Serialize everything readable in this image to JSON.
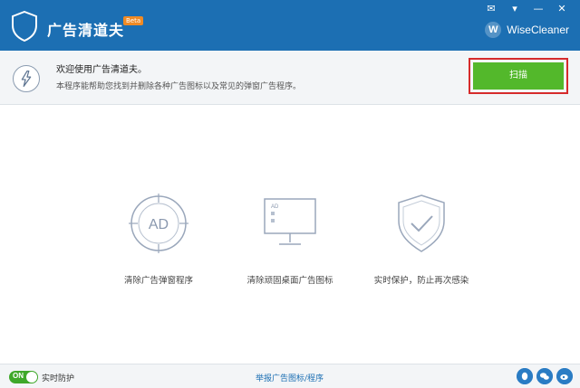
{
  "header": {
    "app_title": "广告清道夫",
    "beta_badge": "Beta",
    "brand_mark": "W",
    "brand_name": "WiseCleaner",
    "win_controls": [
      "✉",
      "▾",
      "—",
      "✕"
    ]
  },
  "welcome": {
    "title": "欢迎使用广告清道夫。",
    "description": "本程序能帮助您找到并删除各种广告图标以及常见的弹窗广告程序。",
    "scan_label": "扫描"
  },
  "features": [
    {
      "icon": "ad-block-icon",
      "label": "清除广告弹窗程序",
      "art_text": "AD"
    },
    {
      "icon": "desktop-ad-icon",
      "label": "清除顽固桌面广告图标",
      "art_text": "AD"
    },
    {
      "icon": "shield-check-icon",
      "label": "实时保护，防止再次感染"
    }
  ],
  "footer": {
    "toggle_label": "ON",
    "realtime_label": "实时防护",
    "report_link": "举报广告图标/程序",
    "social": [
      "qq-icon",
      "wechat-icon",
      "weibo-icon"
    ]
  },
  "colors": {
    "titlebar": "#1c6fb3",
    "scan_button": "#53b82b",
    "highlight_outline": "#d62b2b",
    "toggle_on": "#3fa82a"
  }
}
